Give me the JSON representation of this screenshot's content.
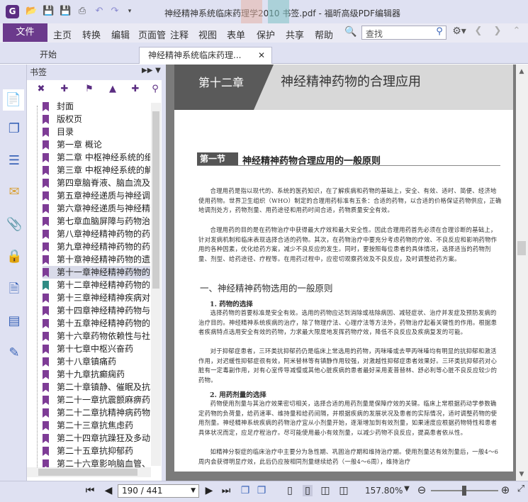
{
  "window": {
    "title": "神经精神系统临床药理学2010 书签.pdf - 福昕高级PDF编辑器",
    "app_icon": "G"
  },
  "ribbon": {
    "file_label": "文件",
    "menus": [
      "主页",
      "转换",
      "编辑",
      "页面管",
      "注释",
      "视图",
      "表单",
      "保护",
      "共享",
      "帮助"
    ],
    "search_placeholder": "查找"
  },
  "tabs": [
    {
      "label": "开始"
    },
    {
      "label": "神经精神系统临床药理..."
    }
  ],
  "bookmark_panel": {
    "title": "书签",
    "items": [
      "封面",
      "版权页",
      "目录",
      "第一章 概论",
      "第二章 中枢神经系统的细",
      "第三章 中枢神经系统的解",
      "第四章脑脊液、脑血流及血",
      "第五章神经递质与神经调",
      "第六章神经递质与神经精",
      "第七章血脑屏障与药物治",
      "第八章神经精神药物的药",
      "第九章神经精神药物的药",
      "第十章神经精神药物的遗",
      "第十一章神经精神药物的",
      "第十二章神经精神药物的",
      "第十三章神经精神疾病对",
      "第十四章神经精神药物与",
      "第十五章神经精神药物的",
      "第十六章药物依赖性与社",
      "第十七章中枢兴奋药",
      "第十八章镇痛药",
      "第十九章抗癫痫药",
      "第二十章镇静、催眠及抗",
      "第二十一章抗震颤麻痹药",
      "第二十二章抗精神病药物",
      "第二十三章抗焦虑药",
      "第二十四章抗躁狂及多动",
      "第二十五章抗抑郁药",
      "第二十六章影响脑血管、"
    ],
    "selected_index": 13,
    "teal_index": 14
  },
  "document": {
    "chapter_number": "第十二章",
    "chapter_title": "神经精神药物的合理应用",
    "section_label": "第一节",
    "section_title": "神经精神药物合理应用的一般原则",
    "p1": "合理用药是指以现代的、系统的医药知识，在了解疾病和药物的基础上，安全、有效、适时、简便、经济地使用药物。世界卫生组织（WHO）制定的合理用药标准有五条：合适的药物，以合适的价格保证药物供应，正确地调剂处方，药物剂量、用药途径和用药时间合适，药物质量安全有效。",
    "p2": "合理用药的目的是在药物治疗中获得最大疗效和最大安全性。因此合理用药首先必须在合理诊断的基础上，针对发病机制和临床表现选择合适的药物。其次，在药物治疗中要充分考虑药物的疗效、不良反应和影响药物作用的各种因素，优化给药方案，减少不良反应的发生。同时，要按照每位患者的具体情况，选择适当的药物剂量、剂型、给药途径、疗程等。在用药过程中，应密切观察药效及不良反应，及时调整给药方案。",
    "h_one": "一、神经精神药物选用的一般原则",
    "h_1": "1. 药物的选择",
    "p3": "选择药物的首要标准是安全有效。选用的药物应达到消除或祛除病因、减轻症状、治疗并发症及预防发病的治疗目的。神经精神系统疾病的治疗，除了物理疗法、心理疗法等方法外，药物治疗起着关键性的作用。根据患者疾病特点选用安全有效的药物，力求最大限度地发挥药物疗效，降低不良反应及疾病复发的可能。",
    "p4": "对于抑郁症患者，三环类抗抑郁药仍是临床上常选用的药物，丙咪嗪或去甲丙咪嗪均有明显的抗抑郁和激活作用，对迟缓性抑郁症很有效，阿米替林等有镇静作用较强，对激越性抑郁症患者效果好。三环类抗抑郁药对心脏有一定毒副作用，对有心室传导减慢或其他心脏疾病的患者最好采用麦普替林、舒必利等心脏不良反应较少的药物。",
    "h_2": "2. 用药剂量的选择",
    "p5": "药物使用剂量与其治疗效果密切相关，选择合适的用药剂量是保障疗效的关键。临床上常根据药动学参数确定药物的负荷量，给药速率、维持量和给药间隔，并根据疾病的发展状况及患者的实际情况，适时调整药物的使用剂量。神经精神系统疾病的药物治疗宜从小剂量开始，逐渐增加到有效剂量，如果速度应根据药物特性和患者具体状况而定，应足疗程治疗。尽可能使用最小有效剂量，以减少药物不良反应，提高患者依从性。",
    "p6": "如精神分裂症的临床治疗中主要分为急性期、巩固治疗期和维持治疗期。使用剂量达有效剂量后，一般4～6周内会获得明显疗效，此后仍应按相同剂量继续给药（一般4～6周），维持治疗"
  },
  "statusbar": {
    "page_value": "190 / 441",
    "zoom": "157.80%"
  }
}
